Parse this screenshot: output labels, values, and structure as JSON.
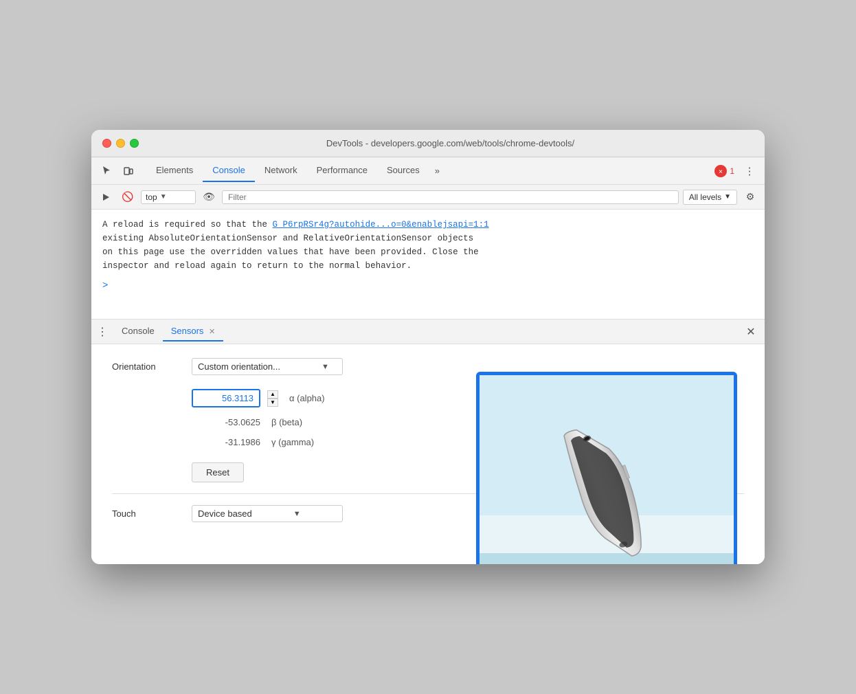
{
  "window": {
    "title": "DevTools - developers.google.com/web/tools/chrome-devtools/"
  },
  "toolbar": {
    "tabs": [
      "Elements",
      "Console",
      "Network",
      "Performance",
      "Sources"
    ],
    "active_tab": "Console",
    "more_label": "»",
    "error_count": "1",
    "menu_icon": "⋮"
  },
  "filter_bar": {
    "run_label": "▶",
    "block_label": "🚫",
    "top_label": "top",
    "dropdown_arrow": "▼",
    "eye_icon": "👁",
    "filter_placeholder": "Filter",
    "all_levels": "All levels",
    "all_levels_arrow": "▼",
    "gear_icon": "⚙"
  },
  "console": {
    "message_part1": "A reload is required so that the ",
    "link_text": "G_P6rpRSr4g?autohide...o=0&enablejsapi=1:1",
    "message_part2": "existing AbsoluteOrientationSensor and RelativeOrientationSensor objects",
    "message_part3": "on this page use the overridden values that have been provided. Close the",
    "message_part4": "inspector and reload again to return to the normal behavior.",
    "prompt": ">"
  },
  "bottom_panel": {
    "menu_icon": "⋮",
    "tabs": [
      {
        "label": "Console",
        "active": false,
        "closeable": false
      },
      {
        "label": "Sensors",
        "active": true,
        "closeable": true
      }
    ],
    "close_icon": "✕"
  },
  "sensors": {
    "orientation_label": "Orientation",
    "orientation_value": "Custom orientation...",
    "orientation_arrow": "▼",
    "alpha_value": "56.3113",
    "alpha_label": "α (alpha)",
    "beta_value": "-53.0625",
    "beta_label": "β (beta)",
    "gamma_value": "-31.1986",
    "gamma_label": "γ (gamma)",
    "reset_label": "Reset",
    "touch_label": "Touch",
    "touch_value": "Device based",
    "touch_arrow": "▼",
    "spinner_up": "▲",
    "spinner_down": "▼"
  }
}
